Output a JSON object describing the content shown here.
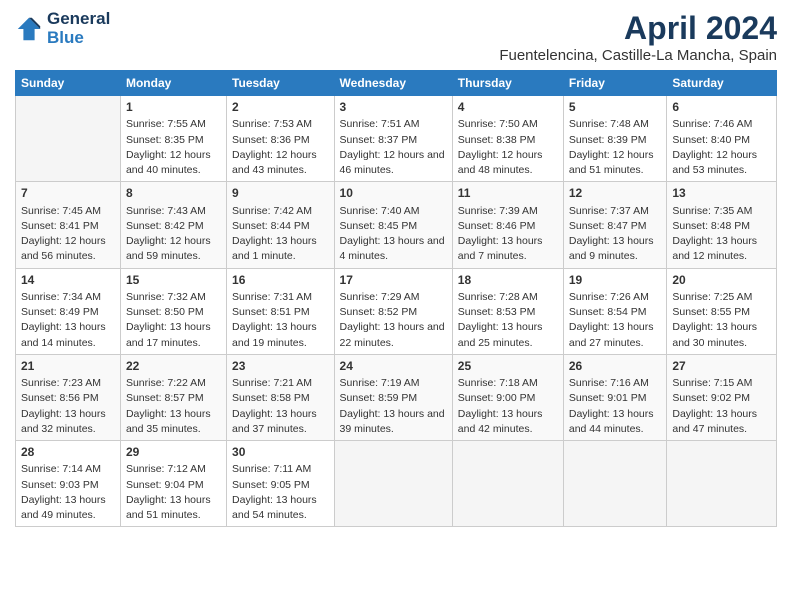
{
  "header": {
    "logo_line1": "General",
    "logo_line2": "Blue",
    "title": "April 2024",
    "subtitle": "Fuentelencina, Castille-La Mancha, Spain"
  },
  "days_of_week": [
    "Sunday",
    "Monday",
    "Tuesday",
    "Wednesday",
    "Thursday",
    "Friday",
    "Saturday"
  ],
  "weeks": [
    [
      {
        "day": "",
        "sunrise": "",
        "sunset": "",
        "daylight": ""
      },
      {
        "day": "1",
        "sunrise": "Sunrise: 7:55 AM",
        "sunset": "Sunset: 8:35 PM",
        "daylight": "Daylight: 12 hours and 40 minutes."
      },
      {
        "day": "2",
        "sunrise": "Sunrise: 7:53 AM",
        "sunset": "Sunset: 8:36 PM",
        "daylight": "Daylight: 12 hours and 43 minutes."
      },
      {
        "day": "3",
        "sunrise": "Sunrise: 7:51 AM",
        "sunset": "Sunset: 8:37 PM",
        "daylight": "Daylight: 12 hours and 46 minutes."
      },
      {
        "day": "4",
        "sunrise": "Sunrise: 7:50 AM",
        "sunset": "Sunset: 8:38 PM",
        "daylight": "Daylight: 12 hours and 48 minutes."
      },
      {
        "day": "5",
        "sunrise": "Sunrise: 7:48 AM",
        "sunset": "Sunset: 8:39 PM",
        "daylight": "Daylight: 12 hours and 51 minutes."
      },
      {
        "day": "6",
        "sunrise": "Sunrise: 7:46 AM",
        "sunset": "Sunset: 8:40 PM",
        "daylight": "Daylight: 12 hours and 53 minutes."
      }
    ],
    [
      {
        "day": "7",
        "sunrise": "Sunrise: 7:45 AM",
        "sunset": "Sunset: 8:41 PM",
        "daylight": "Daylight: 12 hours and 56 minutes."
      },
      {
        "day": "8",
        "sunrise": "Sunrise: 7:43 AM",
        "sunset": "Sunset: 8:42 PM",
        "daylight": "Daylight: 12 hours and 59 minutes."
      },
      {
        "day": "9",
        "sunrise": "Sunrise: 7:42 AM",
        "sunset": "Sunset: 8:44 PM",
        "daylight": "Daylight: 13 hours and 1 minute."
      },
      {
        "day": "10",
        "sunrise": "Sunrise: 7:40 AM",
        "sunset": "Sunset: 8:45 PM",
        "daylight": "Daylight: 13 hours and 4 minutes."
      },
      {
        "day": "11",
        "sunrise": "Sunrise: 7:39 AM",
        "sunset": "Sunset: 8:46 PM",
        "daylight": "Daylight: 13 hours and 7 minutes."
      },
      {
        "day": "12",
        "sunrise": "Sunrise: 7:37 AM",
        "sunset": "Sunset: 8:47 PM",
        "daylight": "Daylight: 13 hours and 9 minutes."
      },
      {
        "day": "13",
        "sunrise": "Sunrise: 7:35 AM",
        "sunset": "Sunset: 8:48 PM",
        "daylight": "Daylight: 13 hours and 12 minutes."
      }
    ],
    [
      {
        "day": "14",
        "sunrise": "Sunrise: 7:34 AM",
        "sunset": "Sunset: 8:49 PM",
        "daylight": "Daylight: 13 hours and 14 minutes."
      },
      {
        "day": "15",
        "sunrise": "Sunrise: 7:32 AM",
        "sunset": "Sunset: 8:50 PM",
        "daylight": "Daylight: 13 hours and 17 minutes."
      },
      {
        "day": "16",
        "sunrise": "Sunrise: 7:31 AM",
        "sunset": "Sunset: 8:51 PM",
        "daylight": "Daylight: 13 hours and 19 minutes."
      },
      {
        "day": "17",
        "sunrise": "Sunrise: 7:29 AM",
        "sunset": "Sunset: 8:52 PM",
        "daylight": "Daylight: 13 hours and 22 minutes."
      },
      {
        "day": "18",
        "sunrise": "Sunrise: 7:28 AM",
        "sunset": "Sunset: 8:53 PM",
        "daylight": "Daylight: 13 hours and 25 minutes."
      },
      {
        "day": "19",
        "sunrise": "Sunrise: 7:26 AM",
        "sunset": "Sunset: 8:54 PM",
        "daylight": "Daylight: 13 hours and 27 minutes."
      },
      {
        "day": "20",
        "sunrise": "Sunrise: 7:25 AM",
        "sunset": "Sunset: 8:55 PM",
        "daylight": "Daylight: 13 hours and 30 minutes."
      }
    ],
    [
      {
        "day": "21",
        "sunrise": "Sunrise: 7:23 AM",
        "sunset": "Sunset: 8:56 PM",
        "daylight": "Daylight: 13 hours and 32 minutes."
      },
      {
        "day": "22",
        "sunrise": "Sunrise: 7:22 AM",
        "sunset": "Sunset: 8:57 PM",
        "daylight": "Daylight: 13 hours and 35 minutes."
      },
      {
        "day": "23",
        "sunrise": "Sunrise: 7:21 AM",
        "sunset": "Sunset: 8:58 PM",
        "daylight": "Daylight: 13 hours and 37 minutes."
      },
      {
        "day": "24",
        "sunrise": "Sunrise: 7:19 AM",
        "sunset": "Sunset: 8:59 PM",
        "daylight": "Daylight: 13 hours and 39 minutes."
      },
      {
        "day": "25",
        "sunrise": "Sunrise: 7:18 AM",
        "sunset": "Sunset: 9:00 PM",
        "daylight": "Daylight: 13 hours and 42 minutes."
      },
      {
        "day": "26",
        "sunrise": "Sunrise: 7:16 AM",
        "sunset": "Sunset: 9:01 PM",
        "daylight": "Daylight: 13 hours and 44 minutes."
      },
      {
        "day": "27",
        "sunrise": "Sunrise: 7:15 AM",
        "sunset": "Sunset: 9:02 PM",
        "daylight": "Daylight: 13 hours and 47 minutes."
      }
    ],
    [
      {
        "day": "28",
        "sunrise": "Sunrise: 7:14 AM",
        "sunset": "Sunset: 9:03 PM",
        "daylight": "Daylight: 13 hours and 49 minutes."
      },
      {
        "day": "29",
        "sunrise": "Sunrise: 7:12 AM",
        "sunset": "Sunset: 9:04 PM",
        "daylight": "Daylight: 13 hours and 51 minutes."
      },
      {
        "day": "30",
        "sunrise": "Sunrise: 7:11 AM",
        "sunset": "Sunset: 9:05 PM",
        "daylight": "Daylight: 13 hours and 54 minutes."
      },
      {
        "day": "",
        "sunrise": "",
        "sunset": "",
        "daylight": ""
      },
      {
        "day": "",
        "sunrise": "",
        "sunset": "",
        "daylight": ""
      },
      {
        "day": "",
        "sunrise": "",
        "sunset": "",
        "daylight": ""
      },
      {
        "day": "",
        "sunrise": "",
        "sunset": "",
        "daylight": ""
      }
    ]
  ]
}
